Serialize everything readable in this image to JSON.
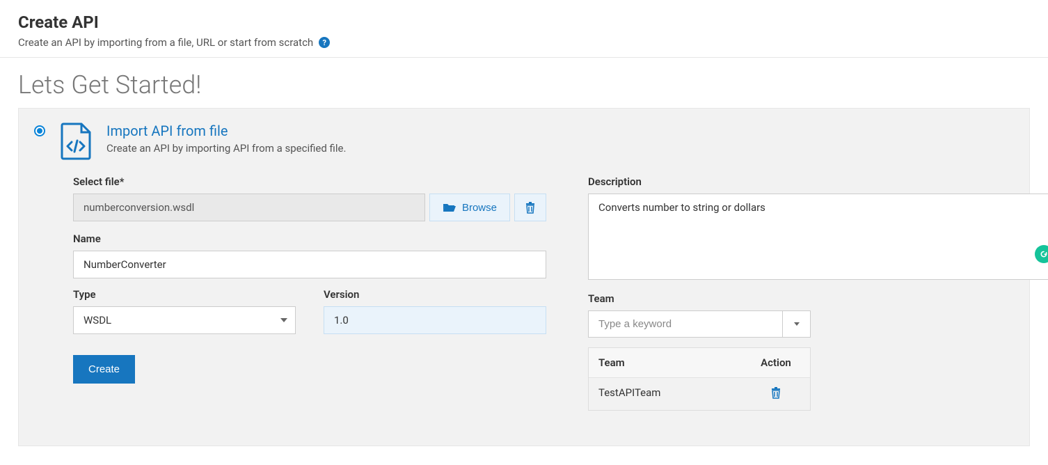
{
  "header": {
    "title": "Create API",
    "subtitle": "Create an API by importing from a file, URL or start from scratch"
  },
  "section_heading": "Lets Get Started!",
  "option": {
    "title": "Import API from file",
    "description": "Create an API by importing API from a specified file."
  },
  "form": {
    "select_file_label": "Select file*",
    "selected_file": "numberconversion.wsdl",
    "browse_label": "Browse",
    "name_label": "Name",
    "name_value": "NumberConverter",
    "type_label": "Type",
    "type_value": "WSDL",
    "version_label": "Version",
    "version_value": "1.0",
    "create_label": "Create",
    "description_label": "Description",
    "description_value": "Converts number to string or dollars",
    "team_label": "Team",
    "team_placeholder": "Type a keyword",
    "team_table": {
      "col_team": "Team",
      "col_action": "Action",
      "rows": [
        {
          "name": "TestAPITeam"
        }
      ]
    }
  }
}
